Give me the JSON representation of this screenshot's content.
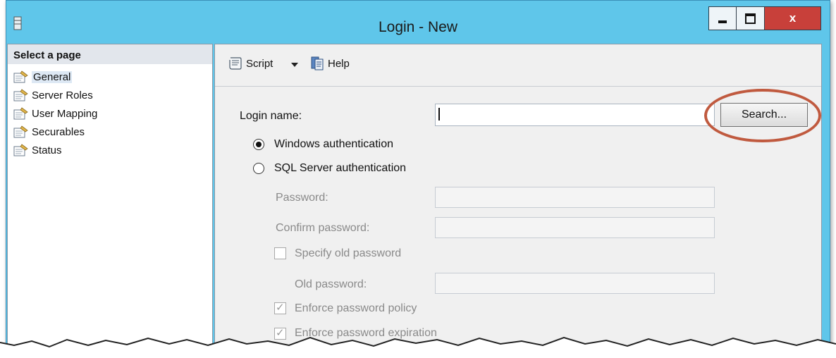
{
  "window": {
    "title": "Login - New",
    "close_glyph": "x"
  },
  "left_pane": {
    "header": "Select a page",
    "items": [
      {
        "label": "General",
        "selected": true,
        "icon": "page-wrench-icon"
      },
      {
        "label": "Server Roles",
        "selected": false,
        "icon": "page-wrench-icon"
      },
      {
        "label": "User Mapping",
        "selected": false,
        "icon": "page-wrench-icon"
      },
      {
        "label": "Securables",
        "selected": false,
        "icon": "page-wrench-icon"
      },
      {
        "label": "Status",
        "selected": false,
        "icon": "page-wrench-icon"
      }
    ]
  },
  "toolbar": {
    "script_label": "Script",
    "help_label": "Help"
  },
  "form": {
    "login_name_label": "Login name:",
    "login_name_value": "",
    "search_button": "Search...",
    "windows_auth_label": "Windows authentication",
    "windows_auth_selected": true,
    "sql_auth_label": "SQL Server authentication",
    "sql_auth_selected": false,
    "password_label": "Password:",
    "confirm_password_label": "Confirm password:",
    "specify_old_password_label": "Specify old password",
    "specify_old_password_checked": false,
    "old_password_label": "Old password:",
    "enforce_policy_label": "Enforce password policy",
    "enforce_policy_checked": true,
    "enforce_expiration_label": "Enforce password expiration",
    "enforce_expiration_checked": true
  },
  "colors": {
    "titlebar": "#5fc6ea",
    "close_button": "#c8403a",
    "annotation_circle": "#c05a3f"
  }
}
